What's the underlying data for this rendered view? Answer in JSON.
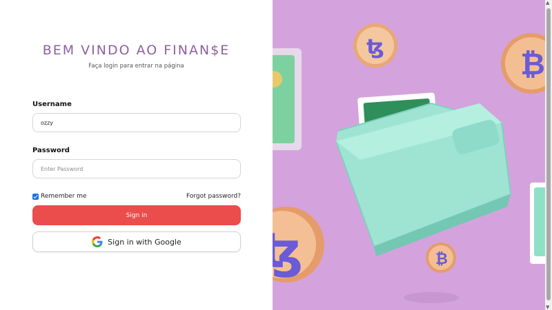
{
  "header": {
    "title": "BEM VINDO AO FINAN$E",
    "subtitle": "Faça login para entrar na página"
  },
  "form": {
    "username_label": "Username",
    "username_value": "ozzy",
    "password_label": "Password",
    "password_placeholder": "Enter Password",
    "remember_label": "Remember me",
    "forgot_label": "Forgot password?",
    "signin_label": "Sign in",
    "google_label": "Sign in with Google"
  },
  "colors": {
    "accent": "#eb4c4c",
    "title": "#8e5f9e",
    "illustration_bg": "#d4a3dd"
  }
}
